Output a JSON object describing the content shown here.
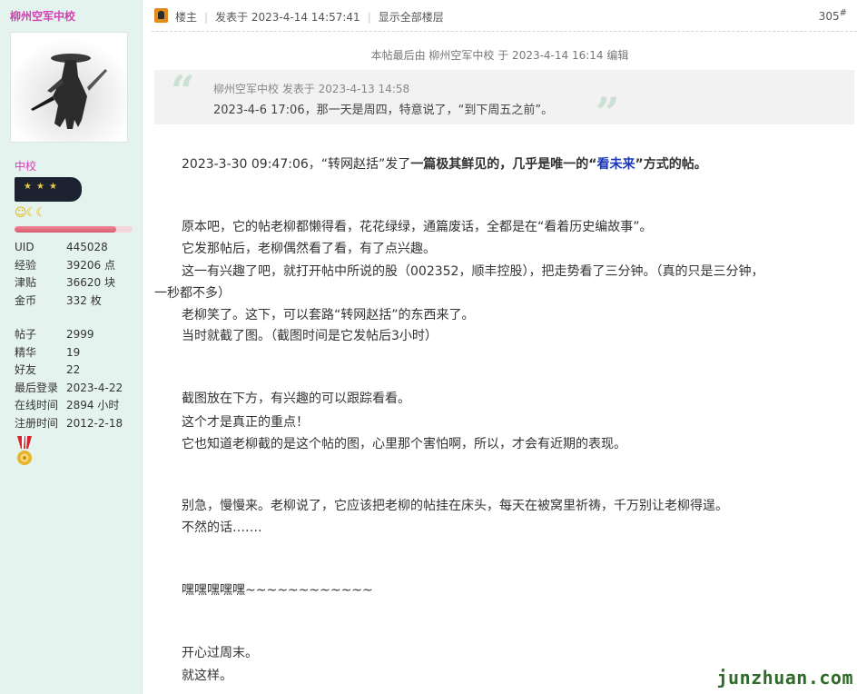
{
  "user": {
    "name": "柳州空军中校",
    "rank": "中校",
    "stats_a": [
      {
        "k": "UID",
        "v": "445028"
      },
      {
        "k": "经验",
        "v": "39206 点"
      },
      {
        "k": "津贴",
        "v": "36620 块"
      },
      {
        "k": "金币",
        "v": "332 枚"
      }
    ],
    "stats_b": [
      {
        "k": "帖子",
        "v": "2999"
      },
      {
        "k": "精华",
        "v": "19"
      },
      {
        "k": "好友",
        "v": "22"
      },
      {
        "k": "最后登录",
        "v": "2023-4-22"
      },
      {
        "k": "在线时间",
        "v": "2894 小时"
      },
      {
        "k": "注册时间",
        "v": "2012-2-18"
      }
    ],
    "progress_pct": 86
  },
  "post": {
    "owner_label": "楼主",
    "posted": "发表于 2023-4-14 14:57:41",
    "show_all": "显示全部楼层",
    "floor_num": "305",
    "floor_mark": "#",
    "edit_note": "本帖最后由 柳州空军中校 于 2023-4-14 16:14 编辑",
    "quote_author": "柳州空军中校 发表于 2023-4-13 14:58",
    "quote_text": "2023-4-6 17:06，那一天是周四，特意说了，“到下周五之前”。",
    "l1a": "2023-3-30 09:47:06，“转网赵括”发了",
    "l1b": "一篇极其鲜见的，几乎是唯一的“",
    "l1c": "看未来",
    "l1d": "”方式的帖。",
    "l2": "原本吧，它的帖老柳都懒得看，花花绿绿，通篇废话，全都是在“看着历史编故事”。",
    "l3": "它发那帖后，老柳偶然看了看，有了点兴趣。",
    "l4": "这一有兴趣了吧，就打开帖中所说的股（002352，顺丰控股），把走势看了三分钟。（真的只是三分钟，",
    "l5": "一秒都不多）",
    "l6": "老柳笑了。这下，可以套路“转网赵括”的东西来了。",
    "l7": "当时就截了图。（截图时间是它发帖后3小时）",
    "l8": "截图放在下方，有兴趣的可以跟踪看看。",
    "l9": "这个才是真正的重点！",
    "l10": "它也知道老柳截的是这个帖的图，心里那个害怕啊，所以，才会有近期的表现。",
    "l11": "别急，慢慢来。老柳说了，它应该把老柳的帖挂在床头，每天在被窝里祈祷，千万别让老柳得逞。",
    "l12": "不然的话…….",
    "l13": "嘿嘿嘿嘿嘿~~~~~~~~~~~~",
    "l14": "开心过周末。",
    "l15": "就这样。"
  },
  "watermark": "junzhuan.com",
  "colors": {
    "sidebar_bg": "#e5f3ee",
    "username": "#d43fb5",
    "link_blue": "#1a37b5",
    "watermark": "#2e6a29"
  }
}
